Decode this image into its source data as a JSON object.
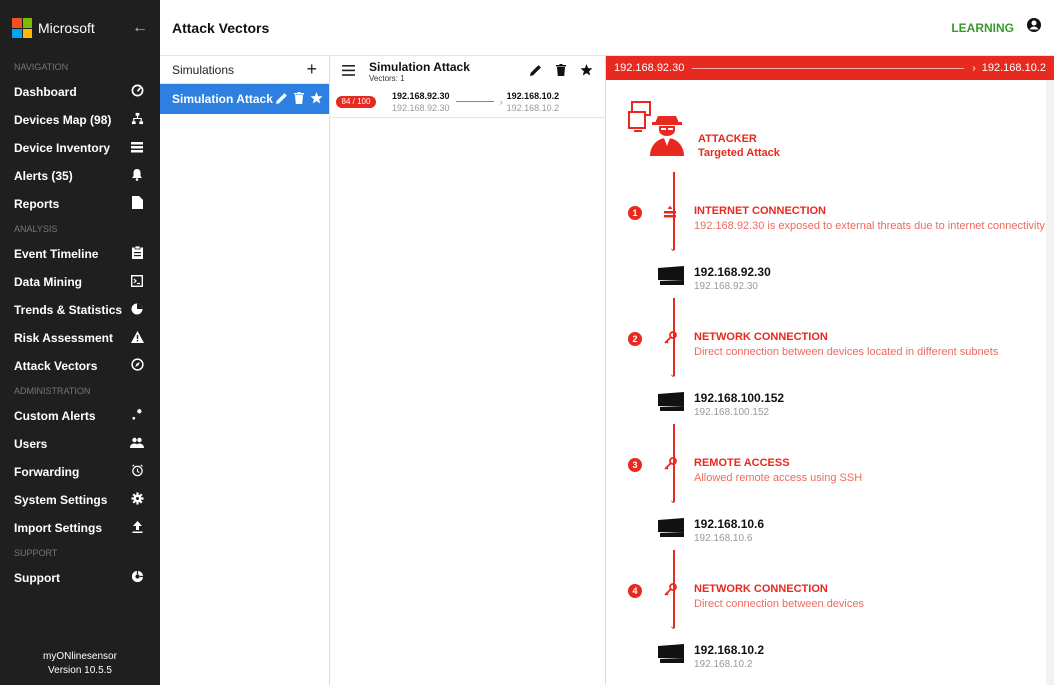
{
  "brand": {
    "name": "Microsoft",
    "logo_colors": [
      "#f25022",
      "#7fba00",
      "#00a4ef",
      "#ffb900"
    ]
  },
  "sidebar": {
    "sections": [
      {
        "title": "NAVIGATION",
        "items": [
          {
            "label": "Dashboard",
            "icon": "gauge-icon"
          },
          {
            "label": "Devices Map (98)",
            "icon": "network-icon"
          },
          {
            "label": "Device Inventory",
            "icon": "list-icon"
          },
          {
            "label": "Alerts (35)",
            "icon": "bell-icon"
          },
          {
            "label": "Reports",
            "icon": "file-icon"
          }
        ]
      },
      {
        "title": "ANALYSIS",
        "items": [
          {
            "label": "Event Timeline",
            "icon": "clipboard-icon"
          },
          {
            "label": "Data Mining",
            "icon": "terminal-icon"
          },
          {
            "label": "Trends & Statistics",
            "icon": "pie-icon"
          },
          {
            "label": "Risk Assessment",
            "icon": "warning-icon"
          },
          {
            "label": "Attack Vectors",
            "icon": "compass-icon"
          }
        ]
      },
      {
        "title": "ADMINISTRATION",
        "items": [
          {
            "label": "Custom Alerts",
            "icon": "sparkle-icon"
          },
          {
            "label": "Users",
            "icon": "users-icon"
          },
          {
            "label": "Forwarding",
            "icon": "alarm-icon"
          },
          {
            "label": "System Settings",
            "icon": "gear-icon"
          },
          {
            "label": "Import Settings",
            "icon": "upload-icon"
          }
        ]
      },
      {
        "title": "SUPPORT",
        "items": [
          {
            "label": "Support",
            "icon": "support-icon"
          }
        ]
      }
    ],
    "footer": {
      "sensor": "myONlinesensor",
      "version": "Version 10.5.5"
    }
  },
  "topbar": {
    "title": "Attack Vectors",
    "mode": "LEARNING"
  },
  "simulations": {
    "header": "Simulations",
    "items": [
      {
        "label": "Simulation Attack"
      }
    ]
  },
  "vectors": {
    "title": "Simulation Attack",
    "count_label": "Vectors: 1",
    "rows": [
      {
        "score": "84 / 100",
        "src_main": "192.168.92.30",
        "src_sub": "192.168.92.30",
        "dst_main": "192.168.10.2",
        "dst_sub": "192.168.10.2"
      }
    ]
  },
  "detail": {
    "source": "192.168.92.30",
    "target": "192.168.10.2",
    "attacker": {
      "title": "ATTACKER",
      "subtitle": "Targeted Attack"
    },
    "steps": [
      {
        "n": "1",
        "icon": "firewall-icon",
        "title": "INTERNET CONNECTION",
        "desc": "192.168.92.30 is exposed to external threats due to internet connectivity",
        "host_main": "192.168.92.30",
        "host_sub": "192.168.92.30"
      },
      {
        "n": "2",
        "icon": "key-icon",
        "title": "NETWORK CONNECTION",
        "desc": "Direct connection between devices located in different subnets",
        "host_main": "192.168.100.152",
        "host_sub": "192.168.100.152"
      },
      {
        "n": "3",
        "icon": "key-icon",
        "title": "REMOTE ACCESS",
        "desc": "Allowed remote access using SSH",
        "host_main": "192.168.10.6",
        "host_sub": "192.168.10.6"
      },
      {
        "n": "4",
        "icon": "key-icon",
        "title": "NETWORK CONNECTION",
        "desc": "Direct connection between devices",
        "host_main": "192.168.10.2",
        "host_sub": "192.168.10.2"
      }
    ]
  },
  "colors": {
    "accent_red": "#e8291f",
    "selected_blue": "#2d7fe0",
    "learning_green": "#3a9a2e",
    "sidebar_bg": "#1f1f1f"
  }
}
